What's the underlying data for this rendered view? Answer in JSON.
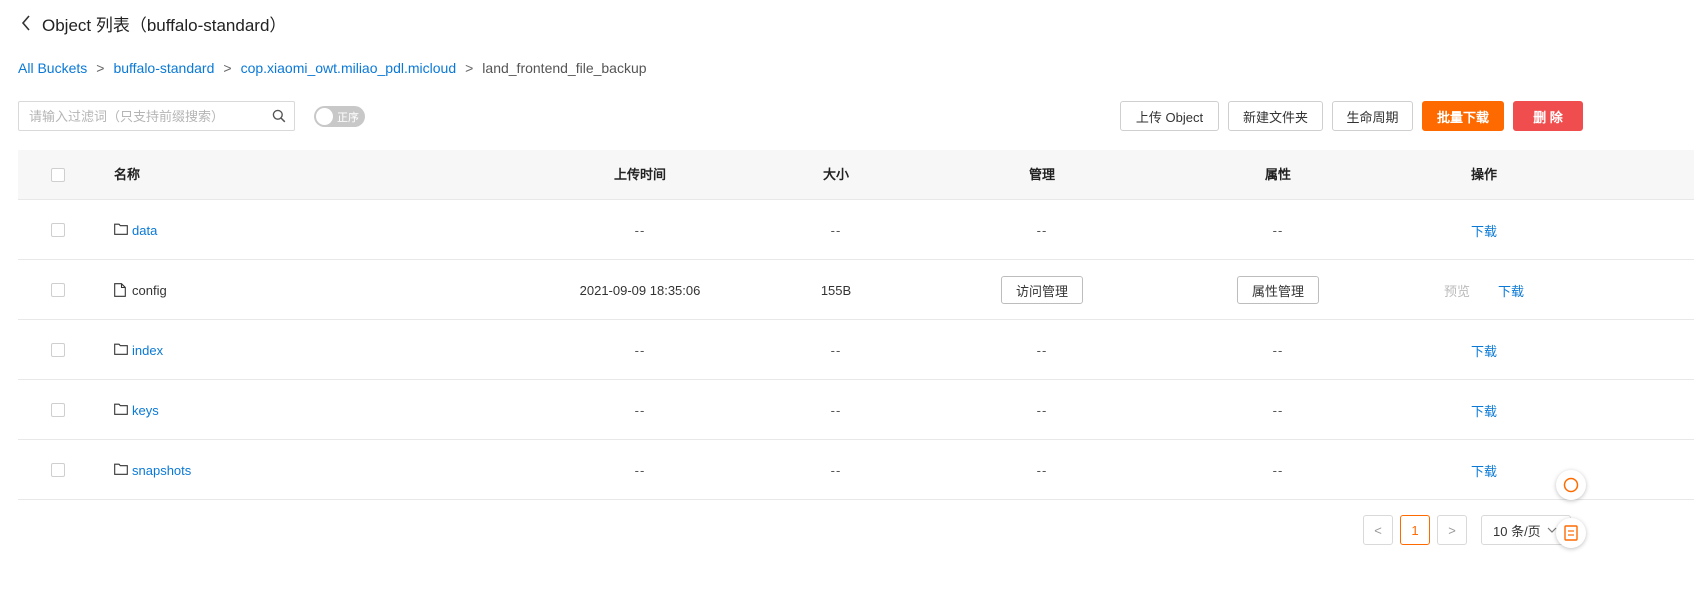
{
  "header": {
    "title": "Object 列表（buffalo-standard）"
  },
  "breadcrumb": {
    "items": [
      "All Buckets",
      "buffalo-standard",
      "cop.xiaomi_owt.miliao_pdl.micloud"
    ],
    "current": "land_frontend_file_backup",
    "separator": ">"
  },
  "toolbar": {
    "search_placeholder": "请输入过滤词（只支持前缀搜索）",
    "search_value": "",
    "sort_toggle_label": "正序",
    "upload_label": "上传 Object",
    "new_folder_label": "新建文件夹",
    "lifecycle_label": "生命周期",
    "batch_download_label": "批量下载",
    "delete_label": "删 除"
  },
  "table": {
    "headers": {
      "name": "名称",
      "upload_time": "上传时间",
      "size": "大小",
      "manage": "管理",
      "attributes": "属性",
      "actions": "操作"
    },
    "rows": [
      {
        "type": "folder",
        "name": "data",
        "upload_time": "--",
        "size": "--",
        "manage": "--",
        "attributes": "--",
        "download": "下载"
      },
      {
        "type": "file",
        "name": "config",
        "upload_time": "2021-09-09 18:35:06",
        "size": "155B",
        "manage": "访问管理",
        "attributes": "属性管理",
        "preview": "预览",
        "download": "下载"
      },
      {
        "type": "folder",
        "name": "index",
        "upload_time": "--",
        "size": "--",
        "manage": "--",
        "attributes": "--",
        "download": "下载"
      },
      {
        "type": "folder",
        "name": "keys",
        "upload_time": "--",
        "size": "--",
        "manage": "--",
        "attributes": "--",
        "download": "下载"
      },
      {
        "type": "folder",
        "name": "snapshots",
        "upload_time": "--",
        "size": "--",
        "manage": "--",
        "attributes": "--",
        "download": "下载"
      }
    ]
  },
  "pagination": {
    "current_page": "1",
    "prev_icon": "<",
    "next_icon": ">",
    "page_size": "10 条/页"
  },
  "colors": {
    "link": "#0a79d6",
    "primary": "#ff6a00",
    "danger": "#f04e4e"
  }
}
